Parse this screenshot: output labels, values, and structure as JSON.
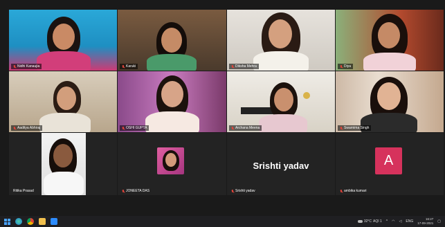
{
  "meeting": {
    "participants": [
      {
        "name": "Nidhi Kanaujia",
        "muted": true
      },
      {
        "name": "Karuki",
        "muted": true
      },
      {
        "name": "Diksha Mehra",
        "muted": true
      },
      {
        "name": "Diya",
        "muted": true,
        "active_speaker": true
      },
      {
        "name": "Aaditya Abhiraj",
        "muted": true
      },
      {
        "name": "OSHI GUPTA",
        "muted": true
      },
      {
        "name": "Archana Meena",
        "muted": true
      },
      {
        "name": "Swarnima Singh",
        "muted": true
      },
      {
        "name": "Ritika Prasad",
        "muted": false
      },
      {
        "name": "JONEETA DAS",
        "muted": true
      },
      {
        "name": "Srishti yadav",
        "muted": true,
        "display": "Srishti yadav"
      },
      {
        "name": "ambika kumari",
        "muted": true,
        "avatar_letter": "A"
      }
    ]
  },
  "taskbar": {
    "weather": "32°C",
    "aqi": "AQI 1",
    "language": "ENG",
    "time": "16:27",
    "date": "17-09-2021"
  },
  "colors": {
    "active_border": "#e9d46a",
    "avatar_bg": "#d6325c",
    "muted_icon": "#e0443a"
  }
}
